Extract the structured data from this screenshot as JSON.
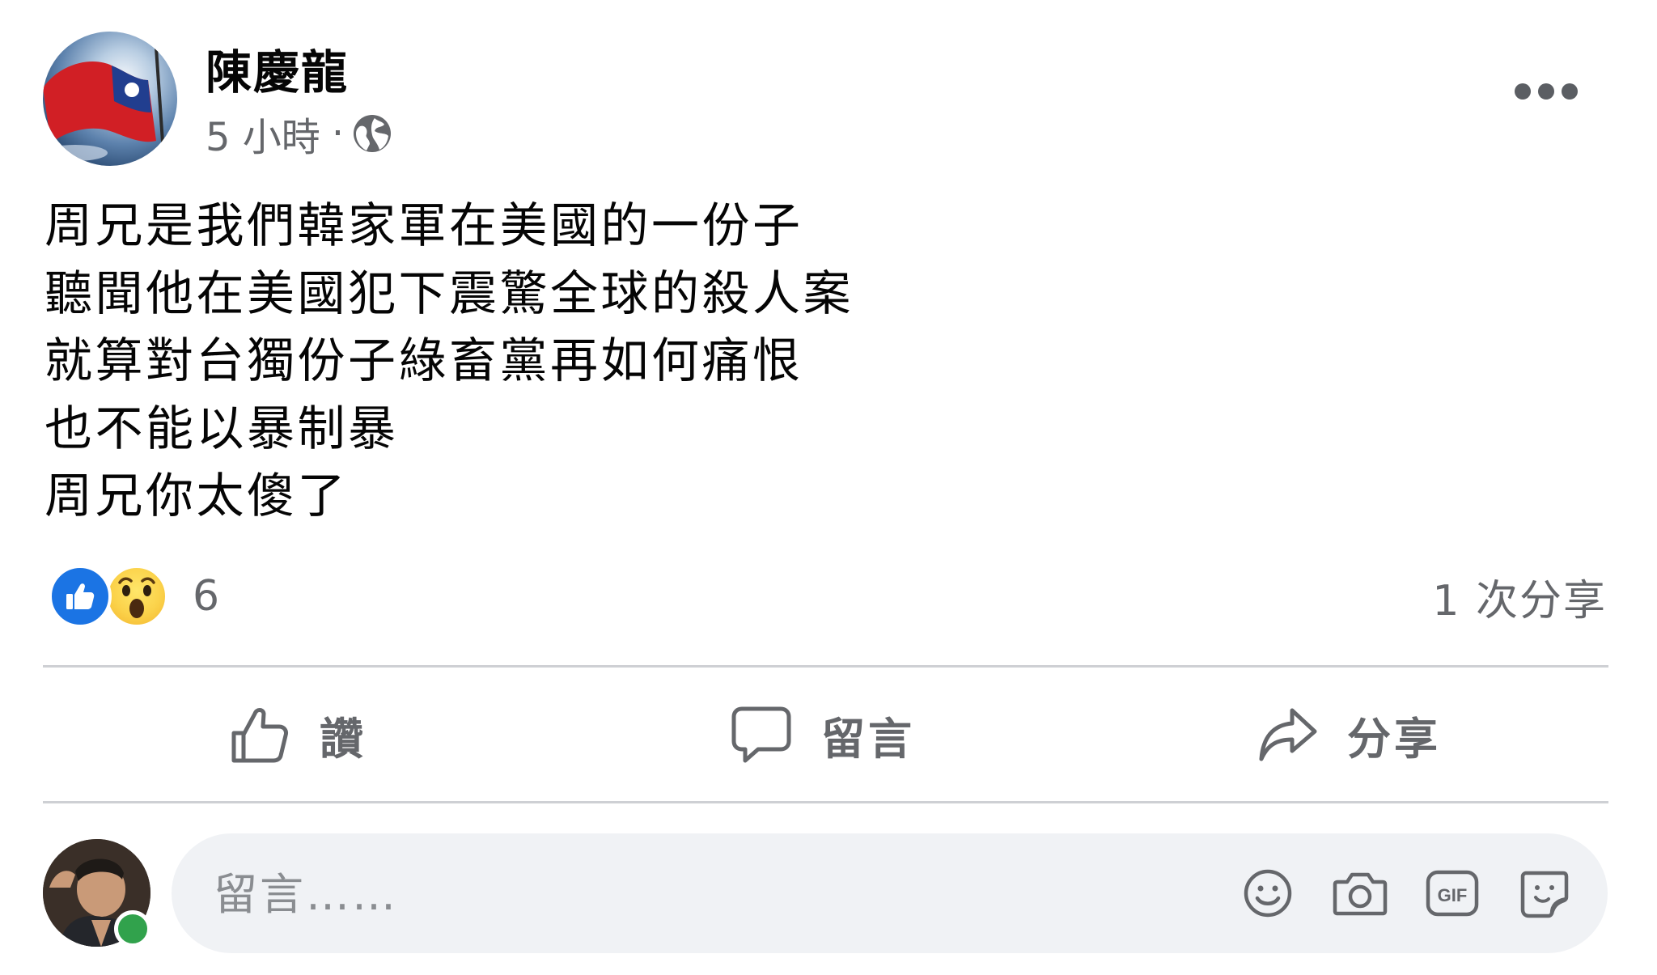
{
  "post": {
    "author": "陳慶龍",
    "time": "5 小時",
    "separator": "·",
    "privacy_icon": "globe-icon",
    "more_icon": "more-options-icon",
    "body_lines": [
      "周兄是我們韓家軍在美國的一份子",
      "聽聞他在美國犯下震驚全球的殺人案",
      "就算對台獨份子綠畜黨再如何痛恨",
      "也不能以暴制暴",
      "周兄你太傻了"
    ]
  },
  "reactions": {
    "types": [
      "like",
      "wow"
    ],
    "count": "6",
    "shares": "1 次分享"
  },
  "actions": {
    "like_label": "讚",
    "comment_label": "留言",
    "share_label": "分享"
  },
  "composer": {
    "placeholder": "留言……",
    "tools": [
      "emoji-icon",
      "camera-icon",
      "gif-icon",
      "sticker-icon"
    ],
    "gif_text": "GIF"
  },
  "colors": {
    "text_primary": "#050505",
    "text_secondary": "#65676b",
    "like_blue": "#1b74e4",
    "wow_yellow": "#fbd24a",
    "composer_bg": "#f0f2f5",
    "online_green": "#31a24c",
    "divider": "#ced0d4"
  }
}
